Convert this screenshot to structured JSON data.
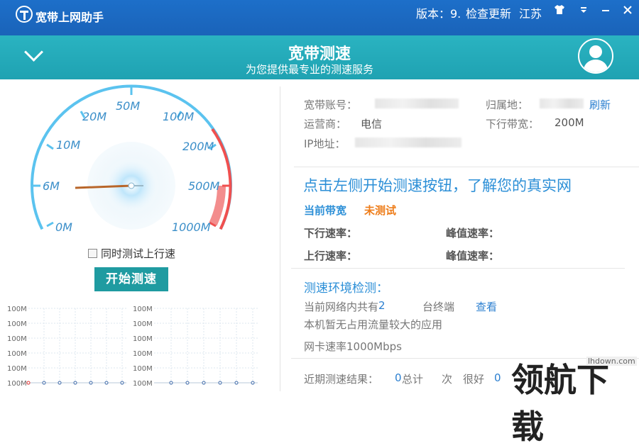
{
  "titlebar": {
    "app_title": "宽带上网助手",
    "version_text": "版本：9.",
    "check_update": "检查更新",
    "region": "江苏",
    "icons": [
      "shirt-icon",
      "dropdown-icon",
      "minimize-icon",
      "close-icon"
    ],
    "color": "#1d6fc9"
  },
  "banner": {
    "title": "宽带测速",
    "subtitle": "为您提供最专业的测速服务",
    "color": "#2ab3c1"
  },
  "gauge": {
    "scale_labels": [
      "0M",
      "6M",
      "10M",
      "20M",
      "50M",
      "100M",
      "200M",
      "500M",
      "1000M"
    ],
    "needle_value": "0M",
    "arc_color": "#5bc3ef",
    "high_color": "#f0504f"
  },
  "controls": {
    "sync_upload_label": "同时测试上行速",
    "start_button": "开始测速"
  },
  "mini_charts": {
    "y_labels": [
      "100M",
      "100M",
      "100M",
      "100M",
      "100M",
      "100M"
    ],
    "bottom_label": "100M"
  },
  "account": {
    "account_label": "宽带账号：",
    "home_label": "归属地：",
    "refresh": "刷新",
    "isp_label": "运营商：",
    "isp_value": "电信",
    "bandwidth_label": "下行带宽：",
    "bandwidth_value": "200M",
    "ip_label": "IP地址："
  },
  "speedtest": {
    "headline": "点击左侧开始测速按钮，了解您的真实网",
    "current_band_label": "当前带宽",
    "current_band_value": "未测试",
    "down_label": "下行速率：",
    "down_peak_label": "峰值速率：",
    "up_label": "上行速率：",
    "up_peak_label": "峰值速率："
  },
  "environment": {
    "title": "测速环境检测：",
    "net_text_a": "当前网络内共有",
    "net_count": "2",
    "net_text_b": "台终端",
    "view_link": "查看",
    "no_app_text": "本机暂无占用流量较大的应用",
    "nic_text": "网卡速率1000Mbps"
  },
  "recent": {
    "label": "近期测速结果：",
    "total_label": "总计",
    "total_count": "0",
    "times": "次",
    "good_label": "很好",
    "good_count": "0"
  },
  "watermark": {
    "text": "领航下载",
    "url": "lhdown.com"
  }
}
